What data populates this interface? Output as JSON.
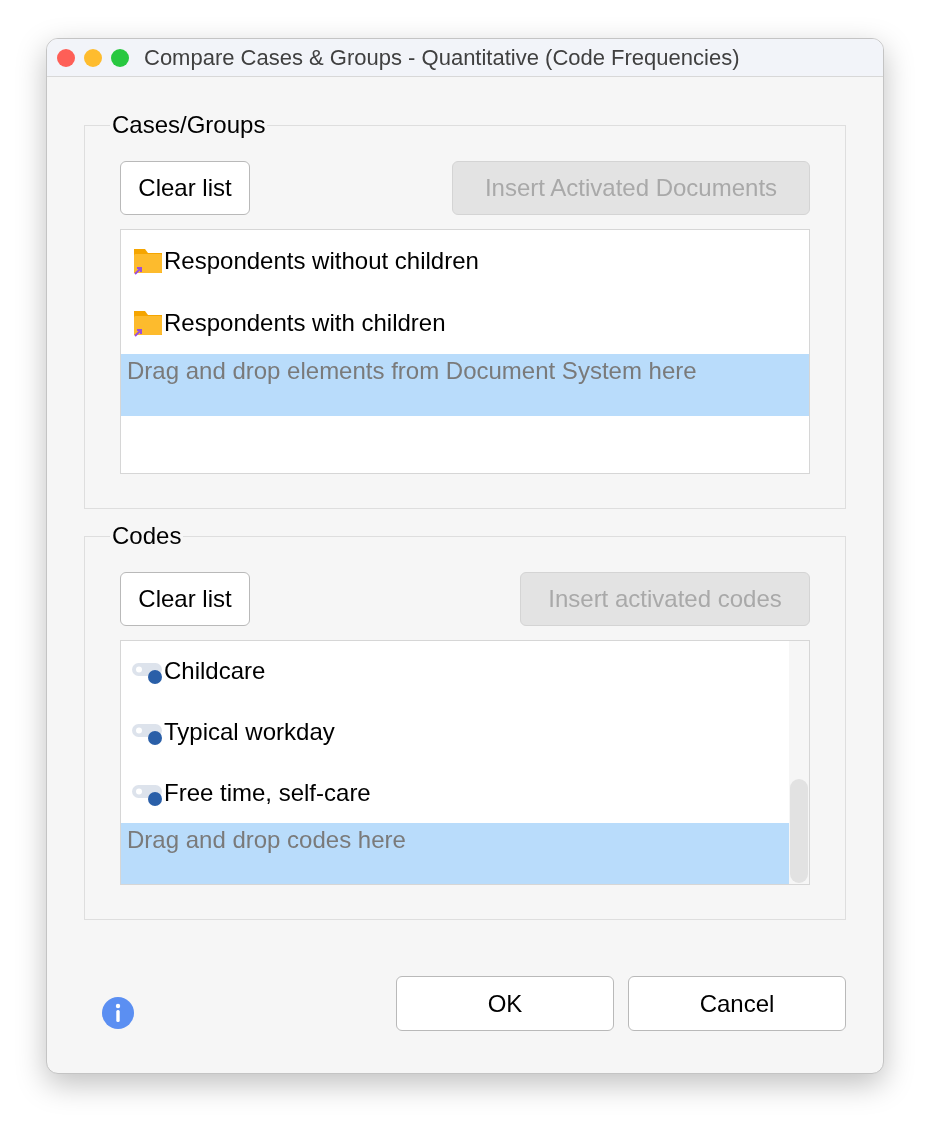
{
  "window": {
    "title": "Compare Cases & Groups - Quantitative (Code Frequencies)"
  },
  "groups": [
    {
      "title": "Cases/Groups",
      "buttons": [
        {
          "label": "Clear list",
          "disabled": false
        },
        {
          "label": "Insert Activated Documents",
          "disabled": true
        }
      ],
      "items": [
        {
          "label": "Respondents without children",
          "kind": "folder"
        },
        {
          "label": "Respondents with children",
          "kind": "folder"
        }
      ],
      "drop_hint": "Drag and drop elements from Document System here",
      "scrollbar": false
    },
    {
      "title": "Codes",
      "buttons": [
        {
          "label": "Clear list",
          "disabled": false
        },
        {
          "label": "Insert activated codes",
          "disabled": true
        }
      ],
      "items": [
        {
          "label": "Childcare",
          "kind": "code"
        },
        {
          "label": "Typical workday",
          "kind": "code"
        },
        {
          "label": "Free time, self-care",
          "kind": "code"
        }
      ],
      "drop_hint": "Drag and drop codes here",
      "scrollbar": true
    }
  ],
  "footer": {
    "buttons": [
      {
        "label": "OK"
      },
      {
        "label": "Cancel"
      }
    ]
  }
}
